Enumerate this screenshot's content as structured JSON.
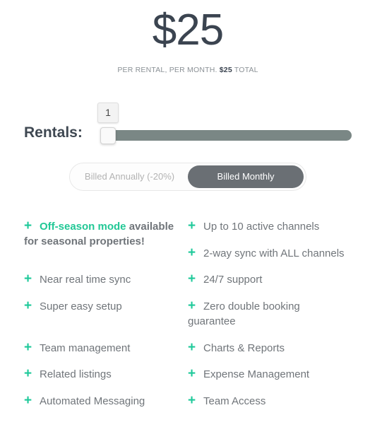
{
  "pricing": {
    "price": "$25",
    "subtitle_prefix": "PER RENTAL, PER MONTH. ",
    "subtitle_total": "$25",
    "subtitle_suffix": " TOTAL"
  },
  "rentals": {
    "label": "Rentals:",
    "value": "1",
    "slider_fraction": 0.0
  },
  "billing": {
    "annual_label": "Billed Annually (-20%)",
    "monthly_label": "Billed Monthly",
    "selected": "monthly"
  },
  "colors": {
    "accent": "#1ec99a",
    "toggle_active": "#6a6f74",
    "slider_track": "#7a8785"
  },
  "features": {
    "left": [
      {
        "highlight": "Off-season mode",
        "text": " available for seasonal properties!"
      },
      {
        "text": "Near real time sync"
      },
      {
        "text": "Super easy setup"
      },
      {
        "text": "Team management"
      },
      {
        "text": "Related listings"
      },
      {
        "text": "Automated Messaging"
      }
    ],
    "right": [
      {
        "text": "Up to 10 active channels"
      },
      {
        "text": "2-way sync with ALL channels"
      },
      {
        "text": "24/7 support"
      },
      {
        "text": "Zero double booking guarantee"
      },
      {
        "text": "Charts & Reports"
      },
      {
        "text": "Expense Management"
      },
      {
        "text": "Team Access"
      }
    ]
  }
}
